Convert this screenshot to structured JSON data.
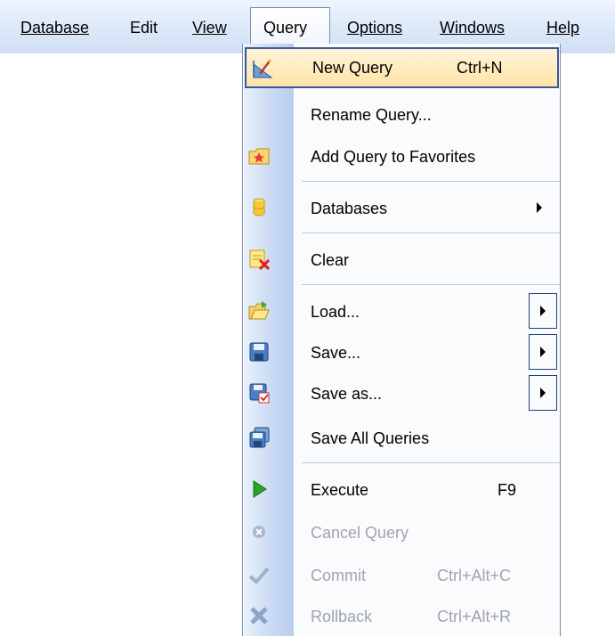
{
  "menubar": {
    "items": [
      {
        "label": "Database"
      },
      {
        "label": "Edit"
      },
      {
        "label": "View"
      },
      {
        "label": "Query"
      },
      {
        "label": "Options"
      },
      {
        "label": "Windows"
      },
      {
        "label": "Help"
      }
    ]
  },
  "query_menu": {
    "items": [
      {
        "label": "New Query",
        "shortcut": "Ctrl+N",
        "icon": "new-query-icon",
        "state": "highlighted"
      },
      {
        "label": "Rename Query...",
        "icon": "none"
      },
      {
        "label": "Add Query to Favorites",
        "icon": "favorites-star-icon"
      },
      {
        "label": "Databases",
        "icon": "database-icon",
        "submenu": true
      },
      {
        "label": "Clear",
        "icon": "clear-icon"
      },
      {
        "label": "Load...",
        "icon": "load-folder-icon",
        "submenu": true
      },
      {
        "label": "Save...",
        "icon": "save-disk-icon",
        "submenu": true
      },
      {
        "label": "Save as...",
        "icon": "save-as-icon",
        "submenu": true
      },
      {
        "label": "Save All Queries",
        "icon": "save-all-icon"
      },
      {
        "label": "Execute",
        "shortcut": "F9",
        "icon": "execute-play-icon"
      },
      {
        "label": "Cancel Query",
        "icon": "cancel-icon",
        "state": "disabled"
      },
      {
        "label": "Commit",
        "shortcut": "Ctrl+Alt+C",
        "icon": "commit-check-icon",
        "state": "disabled"
      },
      {
        "label": "Rollback",
        "shortcut": "Ctrl+Alt+R",
        "icon": "rollback-x-icon",
        "state": "disabled"
      }
    ]
  },
  "colors": {
    "menubar": "#dde9f8",
    "highlight_fill": "#ffe4a8",
    "highlight_border": "#3b5998",
    "disabled_text": "#a0a4ab"
  }
}
